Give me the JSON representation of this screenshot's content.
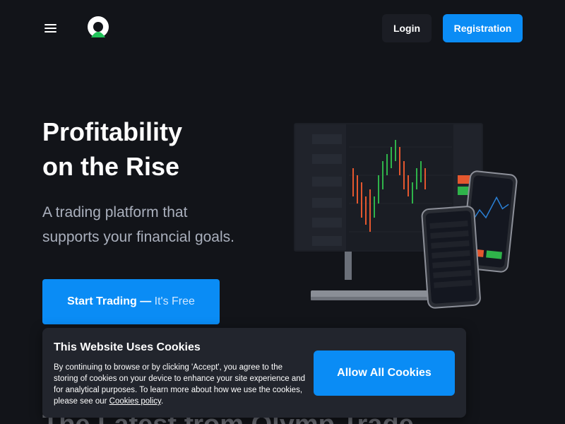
{
  "header": {
    "login_label": "Login",
    "registration_label": "Registration"
  },
  "hero": {
    "title_line1": "Profitability",
    "title_line2": "on the Rise",
    "subtitle_line1": "A trading platform that",
    "subtitle_line2": "supports your financial goals.",
    "cta_main": "Start Trading — ",
    "cta_free": "It's Free"
  },
  "section": {
    "heading": "The Latest from Olymp Trade"
  },
  "cookie": {
    "title": "This Website Uses Cookies",
    "text": "By continuing to browse or by clicking 'Accept', you agree to the storing of cookies on your device to enhance your site experience and for analytical purposes. To learn more about how we use the cookies, please see our ",
    "link": "Cookies policy",
    "text_end": ".",
    "button": "Allow All Cookies"
  },
  "colors": {
    "background": "#121419",
    "accent": "#0a8cf5",
    "banner": "#22252d",
    "logo_green": "#21c35a"
  },
  "icons": [
    "menu-icon",
    "logo-icon"
  ]
}
